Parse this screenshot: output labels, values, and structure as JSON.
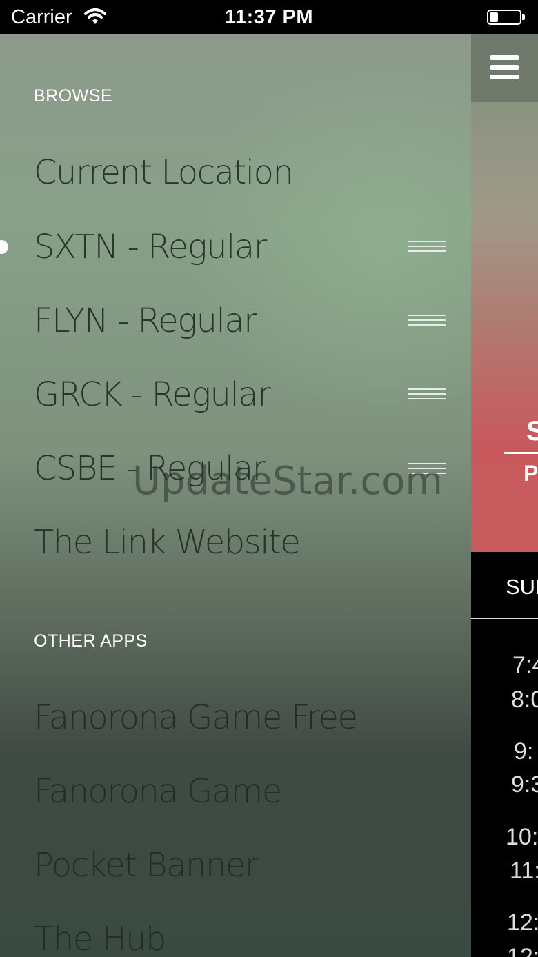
{
  "status_bar": {
    "carrier": "Carrier",
    "time": "11:37 PM"
  },
  "menu": {
    "browse_label": "BROWSE",
    "browse_items": [
      {
        "label": "Current Location"
      },
      {
        "label": "SXTN - Regular"
      },
      {
        "label": "FLYN - Regular"
      },
      {
        "label": "GRCK - Regular"
      },
      {
        "label": "CSBE - Regular"
      },
      {
        "label": "The Link Website"
      }
    ],
    "other_apps_label": "OTHER APPS",
    "other_apps": [
      {
        "label": "Fanorona Game Free"
      },
      {
        "label": "Fanorona Game"
      },
      {
        "label": "Pocket Banner"
      },
      {
        "label": "The Hub"
      }
    ]
  },
  "main_peek": {
    "hero_big": "S",
    "hero_small": "Pi",
    "day_tab": "SUI",
    "times": [
      "7:4",
      "8:0",
      "9:",
      "9:3",
      "10:",
      "11:",
      "12:",
      "12:"
    ]
  },
  "watermark": "UpdateStar.com",
  "colors": {
    "hero_red": "#c85c5e",
    "menu_text": "#1f2a22"
  }
}
